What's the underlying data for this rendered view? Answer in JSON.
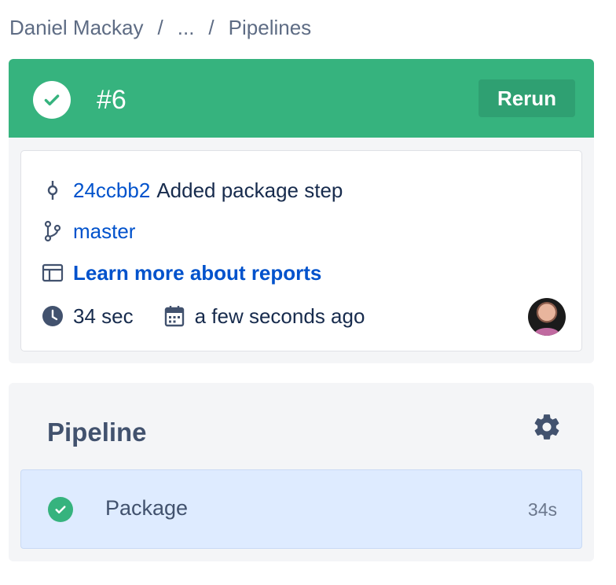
{
  "breadcrumb": {
    "items": [
      "Daniel Mackay",
      "...",
      "Pipelines"
    ],
    "separator": "/"
  },
  "build": {
    "number": "#6",
    "status": "success",
    "rerun_label": "Rerun",
    "commit_hash": "24ccbb2",
    "commit_message": "Added package step",
    "branch": "master",
    "reports_link": "Learn more about reports",
    "duration": "34 sec",
    "time_ago": "a few seconds ago"
  },
  "pipeline": {
    "title": "Pipeline",
    "steps": [
      {
        "name": "Package",
        "duration": "34s",
        "status": "success"
      }
    ]
  },
  "colors": {
    "success": "#36b37e",
    "link": "#0052cc",
    "step_bg": "#deebff"
  },
  "icons": [
    "success-check-icon",
    "commit-icon",
    "branch-icon",
    "reports-icon",
    "clock-icon",
    "calendar-icon",
    "gear-icon"
  ]
}
